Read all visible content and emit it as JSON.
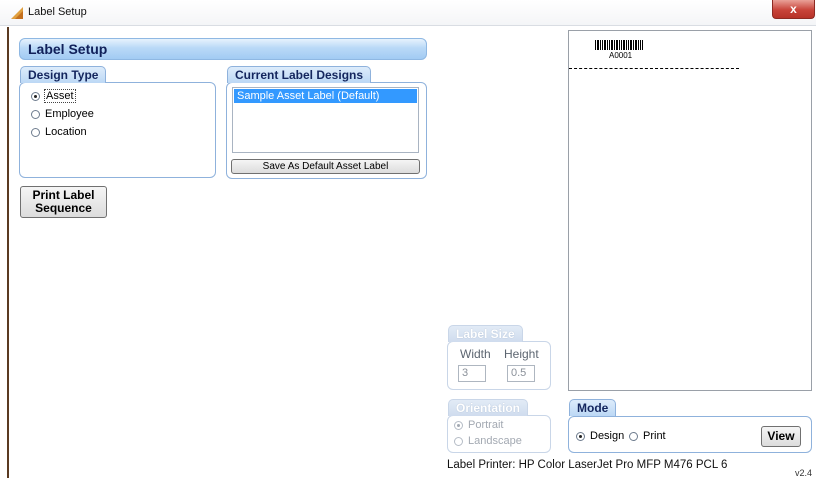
{
  "window": {
    "title": "Label Setup",
    "close_glyph": "x"
  },
  "header": {
    "title": "Label Setup"
  },
  "design_type": {
    "label": "Design Type",
    "options": [
      {
        "label": "Asset",
        "selected": true
      },
      {
        "label": "Employee",
        "selected": false
      },
      {
        "label": "Location",
        "selected": false
      }
    ]
  },
  "current_designs": {
    "label": "Current Label Designs",
    "items": [
      "Sample Asset Label  (Default)"
    ],
    "save_default_label": "Save As Default Asset Label"
  },
  "print_sequence": {
    "line1": "Print Label",
    "line2": "Sequence"
  },
  "preview": {
    "barcode_text": "A0001"
  },
  "label_size": {
    "label": "Label Size",
    "width_label": "Width",
    "height_label": "Height",
    "width_value": "3",
    "height_value": "0.5"
  },
  "orientation": {
    "label": "Orientation",
    "options": [
      {
        "label": "Portrait",
        "selected": true
      },
      {
        "label": "Landscape",
        "selected": false
      }
    ]
  },
  "mode": {
    "label": "Mode",
    "options": [
      {
        "label": "Design",
        "selected": true
      },
      {
        "label": "Print",
        "selected": false
      }
    ],
    "view_label": "View"
  },
  "footer": {
    "printer_text": "Label Printer:  HP Color LaserJet Pro MFP M476 PCL 6",
    "version": "v2.4"
  },
  "colors": {
    "selection": "#3399ff",
    "group_border": "#8fb2dc",
    "close_red": "#c8443a"
  }
}
